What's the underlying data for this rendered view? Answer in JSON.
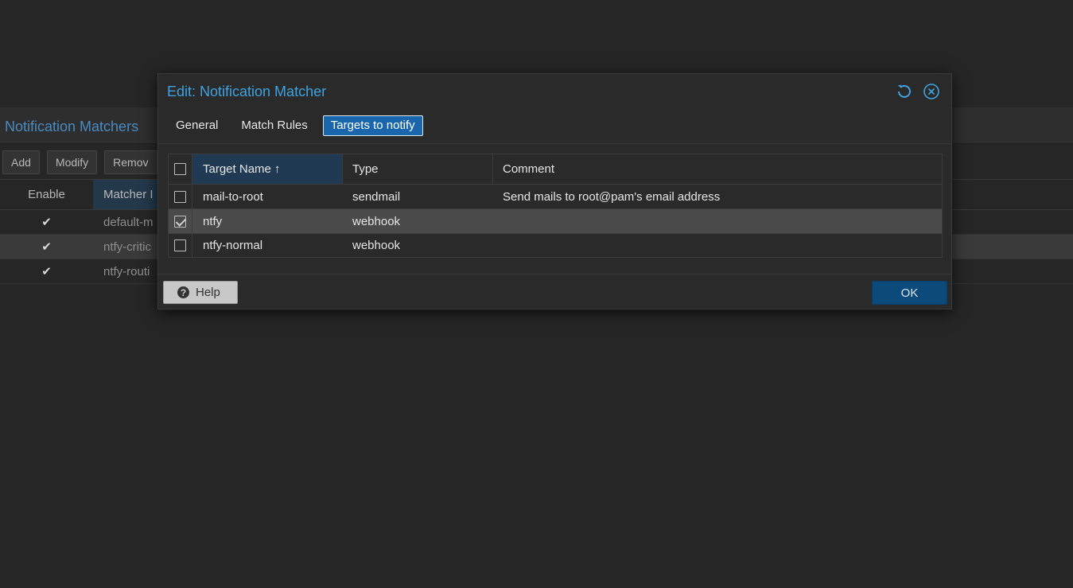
{
  "background": {
    "panel_title": "Notification Matchers",
    "toolbar": [
      "Add",
      "Modify",
      "Remov"
    ],
    "columns": {
      "enable": "Enable",
      "name": "Matcher I"
    },
    "rows": [
      {
        "enable": "✔",
        "name": "default-m",
        "selected": false
      },
      {
        "enable": "✔",
        "name": "ntfy-critic",
        "selected": true
      },
      {
        "enable": "✔",
        "name": "ntfy-routi",
        "selected": false
      }
    ]
  },
  "dialog": {
    "title": "Edit: Notification Matcher",
    "tools": {
      "refresh": "refresh-icon",
      "close": "close-circle-icon"
    },
    "tabs": [
      {
        "label": "General",
        "active": false
      },
      {
        "label": "Match Rules",
        "active": false
      },
      {
        "label": "Targets to notify",
        "active": true
      }
    ],
    "grid": {
      "headers": {
        "name": "Target Name",
        "type": "Type",
        "comment": "Comment"
      },
      "sort_icon": "↑",
      "rows": [
        {
          "name": "mail-to-root",
          "type": "sendmail",
          "comment": "Send mails to root@pam's email address",
          "checked": false
        },
        {
          "name": "ntfy",
          "type": "webhook",
          "comment": "",
          "checked": true
        },
        {
          "name": "ntfy-normal",
          "type": "webhook",
          "comment": "",
          "checked": false
        }
      ]
    },
    "help_label": "Help",
    "ok_label": "OK"
  },
  "colors": {
    "accent": "#3fa3e0",
    "active_tab": "#1966ac",
    "ok_button": "#0c4a7c"
  }
}
